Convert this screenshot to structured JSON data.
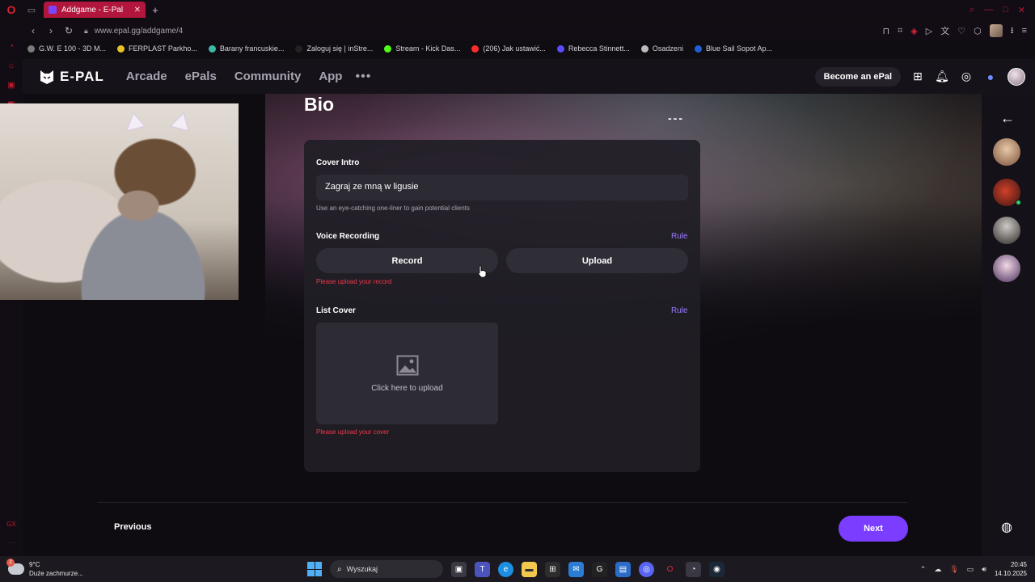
{
  "browser": {
    "tab_title": "Addgame - E-Pal",
    "url": "www.epal.gg/addgame/4",
    "bookmarks": [
      {
        "label": "G.W. E 100 - 3D M...",
        "color": "#7a7a7a"
      },
      {
        "label": "FERPLAST Parkho...",
        "color": "#e6c229"
      },
      {
        "label": "Barany francuskie...",
        "color": "#3fb7a6"
      },
      {
        "label": "Zaloguj się | inStre...",
        "color": "#222222"
      },
      {
        "label": "Stream - Kick Das...",
        "color": "#53fc18"
      },
      {
        "label": "(206) Jak ustawić...",
        "color": "#ff2a2a"
      },
      {
        "label": "Rebecca Stinnett...",
        "color": "#5a4cff"
      },
      {
        "label": "Osadzeni",
        "color": "#bbbbbb"
      },
      {
        "label": "Blue Sail Sopot Ap...",
        "color": "#1f5fd6"
      }
    ]
  },
  "header": {
    "logo": "E-PAL",
    "nav": [
      "Arcade",
      "ePals",
      "Community",
      "App"
    ],
    "more": "•••",
    "become_label": "Become an ePal"
  },
  "page": {
    "title": "Bio",
    "dashes": "---",
    "cover_intro": {
      "label": "Cover Intro",
      "value": "Zagraj ze mną w ligusie",
      "hint": "Use an eye-catching one-liner to gain potential clients"
    },
    "voice": {
      "label": "Voice Recording",
      "rule": "Rule",
      "record": "Record",
      "upload": "Upload",
      "error": "Please upload your record"
    },
    "list_cover": {
      "label": "List Cover",
      "rule": "Rule",
      "upload_text": "Click here to upload",
      "error": "Please upload your cover"
    },
    "prev_label": "Previous",
    "next_label": "Next"
  },
  "taskbar": {
    "weather_temp": "9°C",
    "weather_desc": "Duże zachmurze...",
    "weather_badge": "2",
    "search_label": "Wyszukaj",
    "time": "20:45",
    "date": "14.10.2025"
  },
  "colors": {
    "accent": "#7b3dff",
    "error": "#f0394a",
    "tab": "#b3163c"
  }
}
